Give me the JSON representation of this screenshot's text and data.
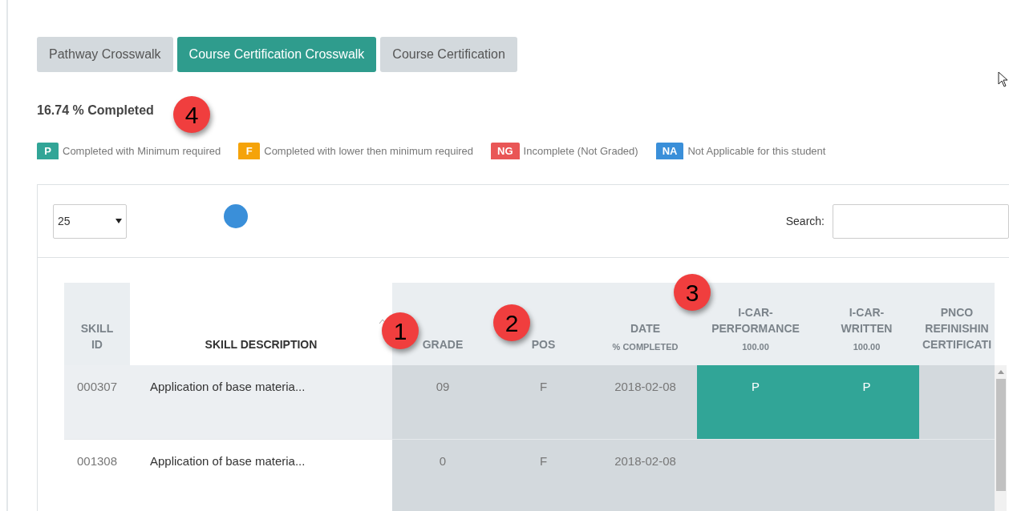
{
  "tabs": [
    {
      "label": "Pathway Crosswalk",
      "selected": false
    },
    {
      "label": "Course Certification Crosswalk",
      "selected": true
    },
    {
      "label": "Course Certification",
      "selected": false
    }
  ],
  "progress_text": "16.74 % Completed",
  "legend": [
    {
      "badge": "P",
      "label": "Completed with Minimum required",
      "color": "#31a597"
    },
    {
      "badge": "F",
      "label": "Completed with lower then minimum required",
      "color": "#f5a30a"
    },
    {
      "badge": "NG",
      "label": "Incomplete (Not Graded)",
      "color": "#e95656"
    },
    {
      "badge": "NA",
      "label": "Not Applicable for this student",
      "color": "#3a8fd9"
    }
  ],
  "page_length": {
    "value": "25"
  },
  "search": {
    "label": "Search:"
  },
  "table": {
    "columns": [
      {
        "lines": [
          "SKILL",
          "ID"
        ]
      },
      {
        "lines": [
          "SKILL DESCRIPTION"
        ],
        "sorted": true
      },
      {
        "lines": [
          "GRADE"
        ]
      },
      {
        "lines": [
          "POS"
        ]
      },
      {
        "lines": [
          "DATE"
        ],
        "sub": "% COMPLETED"
      },
      {
        "lines": [
          "I-CAR-",
          "PERFORMANCE"
        ],
        "sub": "100.00"
      },
      {
        "lines": [
          "I-CAR-",
          "WRITTEN"
        ],
        "sub": "100.00"
      },
      {
        "lines": [
          "PNCO",
          "REFINISHIN",
          "CERTIFICATI"
        ]
      }
    ],
    "rows": [
      {
        "skill_id": "000307",
        "description": "Application of base materia...",
        "grade": "09",
        "pos": "F",
        "date": "2018-02-08",
        "certs": [
          {
            "kind": "graded",
            "text": "P",
            "color": "#31a597"
          },
          {
            "kind": "graded",
            "text": "P",
            "color": "#31a597"
          },
          {
            "kind": "blank"
          }
        ]
      },
      {
        "skill_id": "001308",
        "description": "Application of base materia...",
        "grade": "0",
        "pos": "F",
        "date": "2018-02-08",
        "certs": [
          {
            "kind": "blank"
          },
          {
            "kind": "blank"
          },
          {
            "kind": "blank"
          }
        ]
      }
    ]
  },
  "annotations": [
    {
      "text": "1"
    },
    {
      "text": "2"
    },
    {
      "text": "3"
    },
    {
      "text": "4"
    }
  ]
}
